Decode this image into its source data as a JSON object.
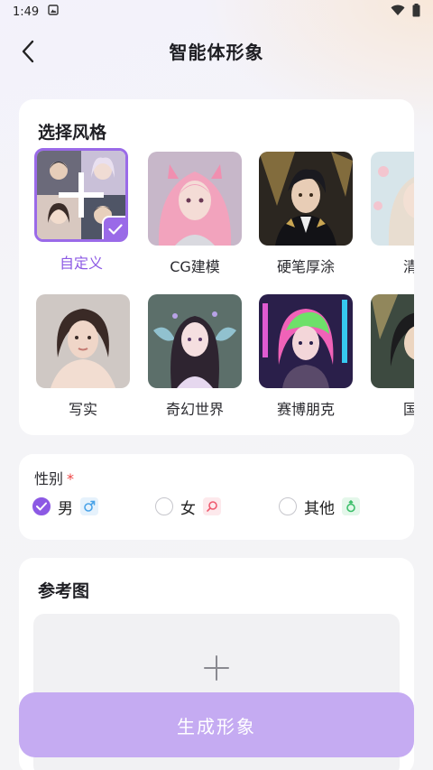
{
  "status": {
    "time": "1:49"
  },
  "header": {
    "title": "智能体形象"
  },
  "styles": {
    "title": "选择风格",
    "items": [
      {
        "label": "自定义",
        "selected": true
      },
      {
        "label": "CG建模"
      },
      {
        "label": "硬笔厚涂"
      },
      {
        "label": "清新"
      },
      {
        "label": "写实"
      },
      {
        "label": "奇幻世界"
      },
      {
        "label": "赛博朋克"
      },
      {
        "label": "国风"
      }
    ]
  },
  "gender": {
    "label": "性别",
    "required_mark": "*",
    "options": [
      {
        "label": "男",
        "checked": true,
        "icon": "male-icon",
        "icon_color": "#4aa3e8"
      },
      {
        "label": "女",
        "checked": false,
        "icon": "female-icon",
        "icon_color": "#ef5a6f"
      },
      {
        "label": "其他",
        "checked": false,
        "icon": "other-gender-icon",
        "icon_color": "#3cbf6a"
      }
    ]
  },
  "reference": {
    "title": "参考图"
  },
  "actions": {
    "generate_label": "生成形象"
  },
  "colors": {
    "accent": "#8c59e4",
    "button": "#c5abf2"
  }
}
